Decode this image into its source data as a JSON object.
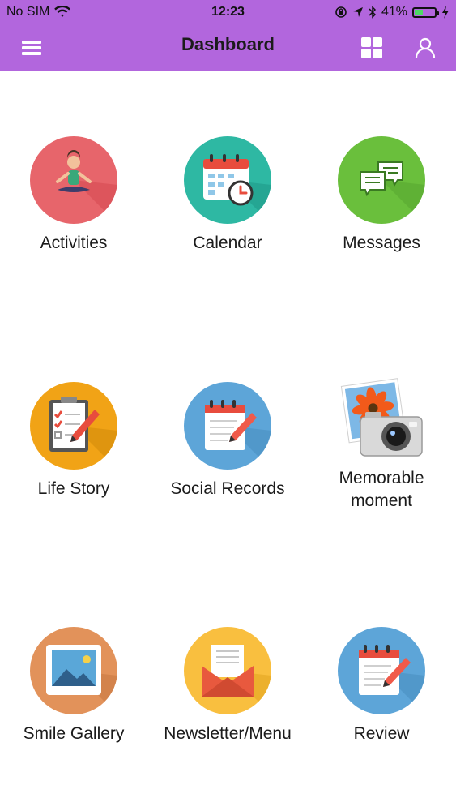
{
  "status_bar": {
    "carrier": "No SIM",
    "time": "12:23",
    "battery": "41%",
    "battery_level": 0.41
  },
  "header": {
    "title": "Dashboard",
    "menu_icon": "hamburger-icon",
    "grid_icon": "grid-icon",
    "user_icon": "user-icon"
  },
  "tiles": [
    {
      "label": "Activities",
      "icon": "yoga-icon",
      "color": "#e7656b"
    },
    {
      "label": "Calendar",
      "icon": "calendar-icon",
      "color": "#2eb8a3"
    },
    {
      "label": "Messages",
      "icon": "chat-bubbles-icon",
      "color": "#6abf3c"
    },
    {
      "label": "Life Story",
      "icon": "clipboard-checklist-icon",
      "color": "#f1a316"
    },
    {
      "label": "Social Records",
      "icon": "notepad-pen-icon",
      "color": "#5da5d8"
    },
    {
      "label": "Memorable moment",
      "icon": "photo-camera-icon",
      "color": "#ffffff"
    },
    {
      "label": "Smile Gallery",
      "icon": "picture-frame-icon",
      "color": "#e2925a"
    },
    {
      "label": "Newsletter/Menu",
      "icon": "envelope-letter-icon",
      "color": "#f9bf3f"
    },
    {
      "label": "Review",
      "icon": "notepad-pen-icon",
      "color": "#5da5d8"
    }
  ]
}
